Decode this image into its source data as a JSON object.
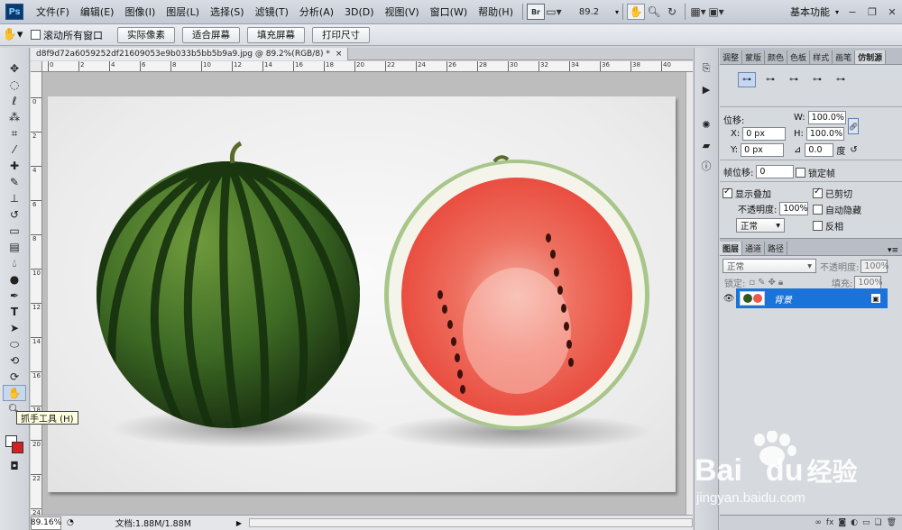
{
  "app": {
    "logo": "Ps"
  },
  "menu": [
    "文件(F)",
    "编辑(E)",
    "图像(I)",
    "图层(L)",
    "选择(S)",
    "滤镜(T)",
    "分析(A)",
    "3D(D)",
    "视图(V)",
    "窗口(W)",
    "帮助(H)"
  ],
  "appbar": {
    "zoom": "89.2",
    "workspace": "基本功能"
  },
  "options": {
    "scroll_all_label": "滚动所有窗口",
    "buttons": [
      "实际像素",
      "适合屏幕",
      "填充屏幕",
      "打印尺寸"
    ]
  },
  "document": {
    "tab_title": "d8f9d72a6059252df21609053e9b033b5bb5b9a9.jpg @ 89.2%(RGB/8) *",
    "close": "×"
  },
  "ruler": {
    "top_labels": [
      "0",
      "2",
      "4",
      "6",
      "8",
      "10",
      "12",
      "14",
      "16",
      "18",
      "20",
      "22",
      "24",
      "26",
      "28",
      "30",
      "32",
      "34",
      "36",
      "38",
      "40"
    ],
    "left_labels": [
      "0",
      "2",
      "4",
      "6",
      "8",
      "10",
      "12",
      "14",
      "16",
      "18",
      "20",
      "22",
      "24"
    ]
  },
  "tooltip": "抓手工具 (H)",
  "status": {
    "zoom": "89.16%",
    "doc_info": "文档:1.88M/1.88M"
  },
  "colors": {
    "foreground": "#ffffff",
    "background": "#d42020",
    "accent": "#1a73d9"
  },
  "clone_panel": {
    "tabs": [
      "调整",
      "蒙版",
      "颜色",
      "色板",
      "样式",
      "画笔",
      "仿制源"
    ],
    "active_tab": "仿制源",
    "offset_label": "位移:",
    "w_label": "W:",
    "w_value": "100.0%",
    "h_label": "H:",
    "h_value": "100.0%",
    "x_label": "X:",
    "x_value": "0 px",
    "y_label": "Y:",
    "y_value": "0 px",
    "angle_value": "0.0",
    "angle_unit": "度",
    "frame_offset_label": "帧位移:",
    "frame_offset_value": "0",
    "lock_frame_label": "锁定帧",
    "show_overlay_label": "显示叠加",
    "clipped_label": "已剪切",
    "opacity_label": "不透明度:",
    "opacity_value": "100%",
    "auto_hide_label": "自动隐藏",
    "mode_value": "正常",
    "invert_label": "反相"
  },
  "layers_panel": {
    "tabs": [
      "图层",
      "通道",
      "路径"
    ],
    "blend_mode": "正常",
    "opacity_label": "不透明度:",
    "opacity_value": "100%",
    "lock_label": "锁定:",
    "fill_label": "填充:",
    "fill_value": "100%",
    "layer_name": "背景",
    "bottom_icons": [
      "fx"
    ]
  },
  "watermark": {
    "brand": "Bai",
    "brand2": "du",
    "cn": "经验",
    "url": "jingyan.baidu.com"
  }
}
